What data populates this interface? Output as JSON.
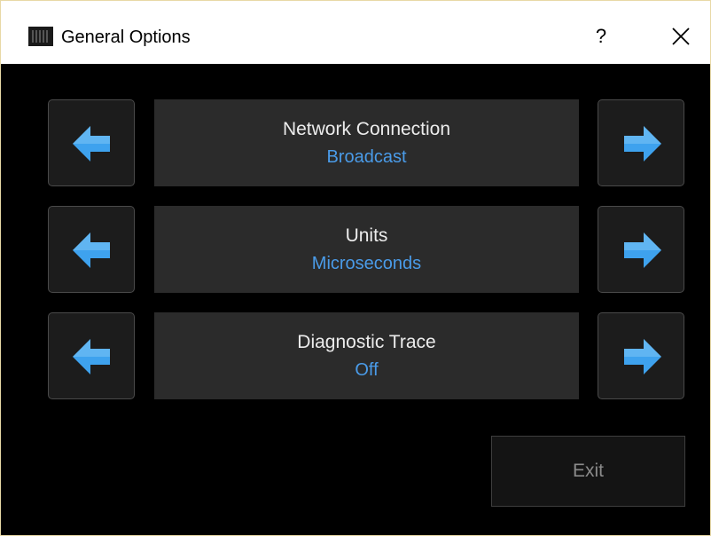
{
  "window": {
    "title": "General Options",
    "help_label": "?"
  },
  "options": [
    {
      "label": "Network Connection",
      "value": "Broadcast"
    },
    {
      "label": "Units",
      "value": "Microseconds"
    },
    {
      "label": "Diagnostic Trace",
      "value": "Off"
    }
  ],
  "exit_label": "Exit",
  "colors": {
    "accent": "#4a9be8",
    "arrow": "#3ea2ee",
    "panel": "#2b2b2b",
    "background": "#000000"
  },
  "icons": {
    "app": "app-grid-icon",
    "prev": "arrow-left-icon",
    "next": "arrow-right-icon",
    "close": "close-icon"
  }
}
